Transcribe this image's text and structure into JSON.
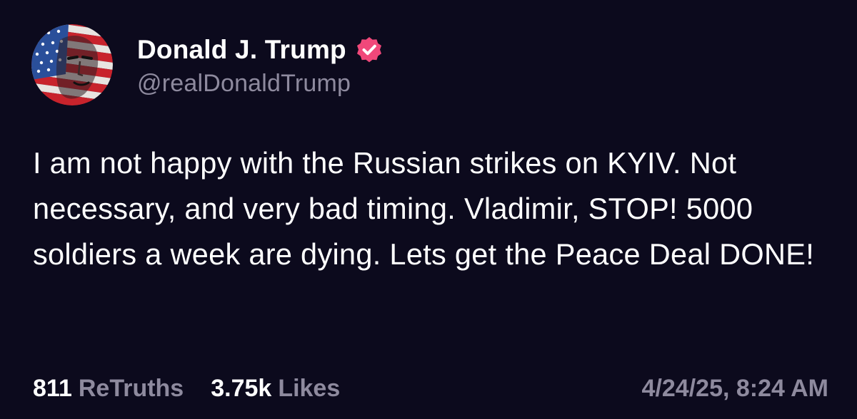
{
  "author": {
    "display_name": "Donald J. Trump",
    "handle": "@realDonaldTrump",
    "verified": true,
    "avatar_icon": "flag-portrait-avatar"
  },
  "post": {
    "text": "I am not happy with the Russian strikes on KYIV. Not necessary, and very bad timing. Vladimir, STOP! 5000 soldiers a week are dying. Lets get the Peace Deal DONE!"
  },
  "stats": {
    "retruths_count": "811",
    "retruths_label": "ReTruths",
    "likes_count": "3.75k",
    "likes_label": "Likes"
  },
  "timestamp": "4/24/25, 8:24 AM",
  "colors": {
    "background": "#0c0a1d",
    "text": "#ffffff",
    "muted": "#8e8a9e",
    "verified_badge": "#f0487a"
  }
}
